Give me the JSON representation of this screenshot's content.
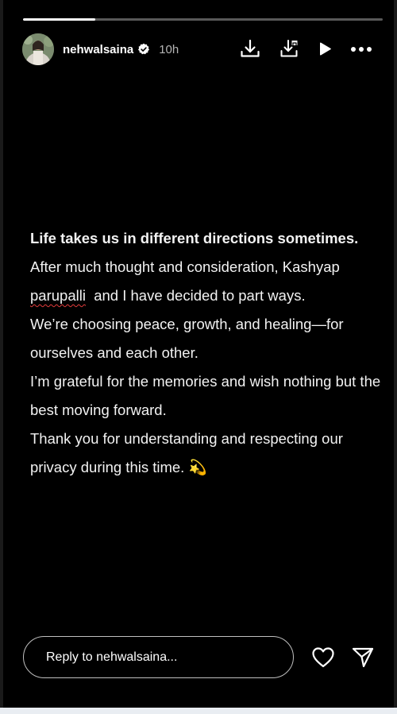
{
  "story": {
    "progress_fraction": 0.2,
    "username": "nehwalsaina",
    "time_ago": "10h",
    "verified": true
  },
  "icons": {
    "download": "download-icon",
    "save": "save-to-device-icon",
    "play": "play-icon",
    "more": "more-options-icon",
    "heart": "heart-icon",
    "send": "send-icon"
  },
  "message": {
    "line1": "Life takes us in different directions sometimes.",
    "line2_part1": "After much thought and consideration, Kashyap ",
    "line2_misspelled": "parupalli",
    "line2_part2": "  and I have decided to part ways.",
    "line3": "We’re choosing peace, growth, and healing—for ourselves and each other.",
    "line4": "I’m grateful for the memories and wish nothing but the best moving forward.",
    "line5": "Thank you for understanding and respecting our privacy during this time. 💫"
  },
  "reply": {
    "placeholder": "Reply to nehwalsaina..."
  },
  "colors": {
    "background": "#000000",
    "text": "#f2f2f2",
    "spellcheck": "#e23b3b"
  }
}
